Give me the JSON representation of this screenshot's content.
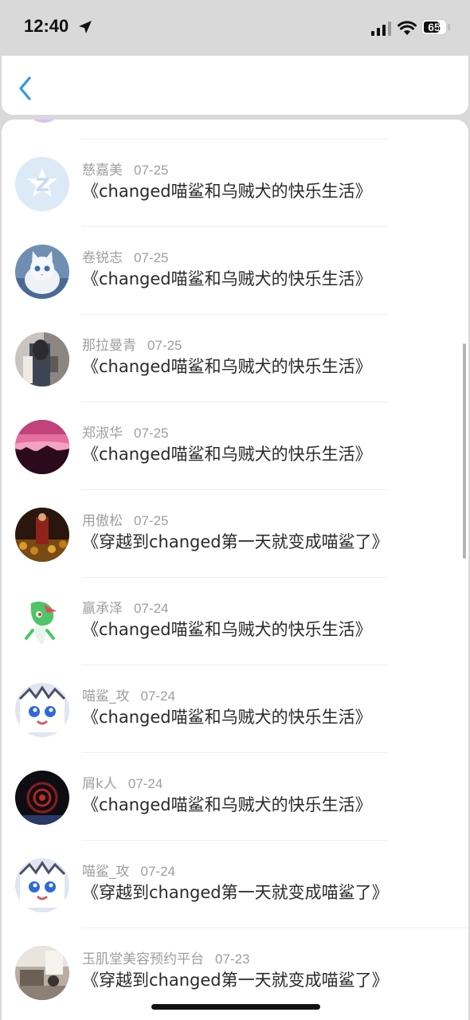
{
  "status": {
    "time": "12:40",
    "battery": "65",
    "icons": [
      "location-arrow-icon",
      "cellular-signal-icon",
      "wifi-icon",
      "battery-icon"
    ]
  },
  "nav": {
    "back_icon": "chevron-left-icon",
    "accent": "#2b9be6"
  },
  "items": [
    {
      "name": "慈嘉美",
      "date": "07-25",
      "title": "《changed喵鲨和乌贼犬的快乐生活》",
      "avatar": "app-logo"
    },
    {
      "name": "卷锐志",
      "date": "07-25",
      "title": "《changed喵鲨和乌贼犬的快乐生活》",
      "avatar": "white-cat"
    },
    {
      "name": "那拉曼青",
      "date": "07-25",
      "title": "《changed喵鲨和乌贼犬的快乐生活》",
      "avatar": "person-photo"
    },
    {
      "name": "郑淑华",
      "date": "07-25",
      "title": "《changed喵鲨和乌贼犬的快乐生活》",
      "avatar": "pink-sunset"
    },
    {
      "name": "用傲松",
      "date": "07-25",
      "title": "《穿越到changed第一天就变成喵鲨了》",
      "avatar": "dark-painting"
    },
    {
      "name": "赢承泽",
      "date": "07-24",
      "title": "《changed喵鲨和乌贼犬的快乐生活》",
      "avatar": "green-creature"
    },
    {
      "name": "喵鲨_攻",
      "date": "07-24",
      "title": "《changed喵鲨和乌贼犬的快乐生活》",
      "avatar": "white-furry"
    },
    {
      "name": "屑k人",
      "date": "07-24",
      "title": "《changed喵鲨和乌贼犬的快乐生活》",
      "avatar": "red-eye"
    },
    {
      "name": "喵鲨_攻",
      "date": "07-24",
      "title": "《穿越到changed第一天就变成喵鲨了》",
      "avatar": "white-furry"
    },
    {
      "name": "玉肌堂美容预约平台",
      "date": "07-23",
      "title": "《穿越到changed第一天就变成喵鲨了》",
      "avatar": "room-photo"
    }
  ]
}
